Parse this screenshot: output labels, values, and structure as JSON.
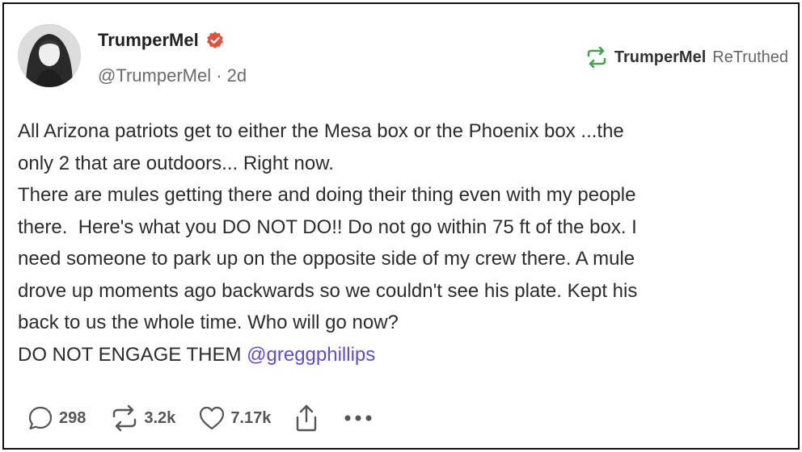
{
  "post": {
    "author_name": "TrumperMel",
    "handle": "@TrumperMel",
    "separator": "·",
    "time": "2d",
    "retruth_name": "TrumperMel",
    "retruth_label": "ReTruthed",
    "body_lines": [
      "All Arizona patriots get to either the Mesa box or the Phoenix box ...the",
      "only 2 that are outdoors... Right now.",
      "There are mules getting there and doing their thing even with my people",
      "there.  Here's what you DO NOT DO!! Do not go within 75 ft of the box. I",
      "need someone to park up on the opposite side of my crew there. A mule",
      "drove up moments ago backwards so we couldn't see his plate. Kept his",
      "back to us the whole time. Who will go now?",
      "DO NOT ENGAGE THEM "
    ],
    "mention": "@greggphillips"
  },
  "actions": {
    "replies": "298",
    "retruths": "3.2k",
    "likes": "7.17k"
  },
  "colors": {
    "verified": "#e0533b",
    "retruth_icon": "#3ea64a",
    "mention": "#5b4fd1",
    "text": "#2c2c2c"
  },
  "icons": [
    "avatar",
    "verified-icon",
    "retruth-icon",
    "reply-icon",
    "retruth-action-icon",
    "like-icon",
    "share-icon",
    "more-icon"
  ]
}
